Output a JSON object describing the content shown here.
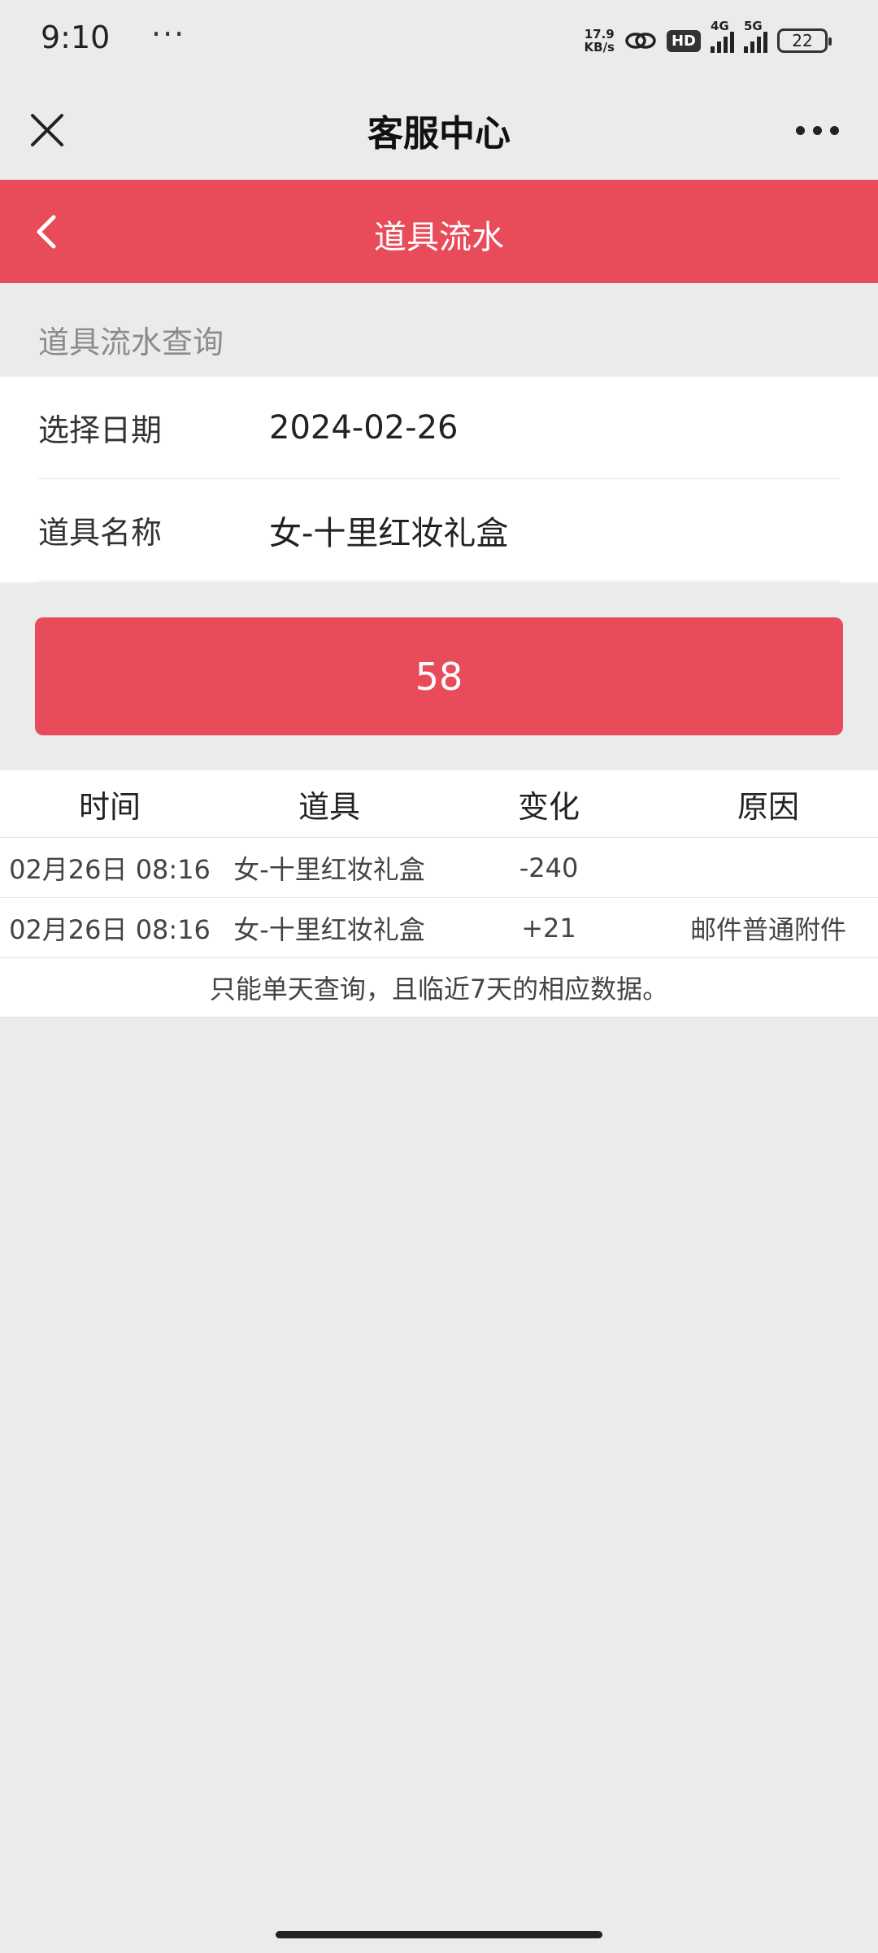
{
  "status_bar": {
    "time": "9:10",
    "dots": "···",
    "net_speed_value": "17.9",
    "net_speed_unit": "KB/s",
    "hd_label": "HD",
    "signal_1": "4G",
    "signal_2": "5G",
    "battery": "22"
  },
  "title_bar": {
    "title": "客服中心"
  },
  "header": {
    "title": "道具流水"
  },
  "section": {
    "label": "道具流水查询"
  },
  "form": {
    "date_label": "选择日期",
    "date_value": "2024-02-26",
    "item_label": "道具名称",
    "item_value": "女-十里红妆礼盒"
  },
  "query_button": {
    "label": "58"
  },
  "table": {
    "headers": [
      "时间",
      "道具",
      "变化",
      "原因"
    ],
    "rows": [
      [
        "02月26日 08:16",
        "女-十里红妆礼盒",
        "-240",
        ""
      ],
      [
        "02月26日 08:16",
        "女-十里红妆礼盒",
        "+21",
        "邮件普通附件"
      ]
    ],
    "note": "只能单天查询，且临近7天的相应数据。"
  }
}
